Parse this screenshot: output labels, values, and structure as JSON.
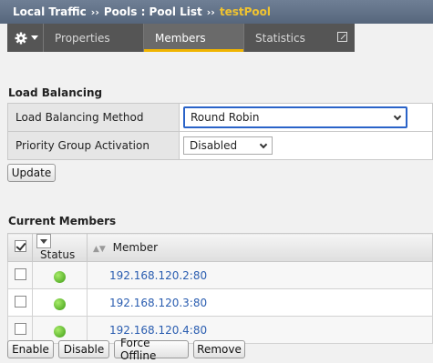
{
  "breadcrumb": {
    "items": [
      "Local Traffic",
      "Pools : Pool List"
    ],
    "current": "testPool",
    "separator": "››"
  },
  "tabs": [
    {
      "label": "Properties"
    },
    {
      "label": "Members",
      "active": true
    },
    {
      "label": "Statistics"
    }
  ],
  "load_balancing": {
    "title": "Load Balancing",
    "method_label": "Load Balancing Method",
    "method_value": "Round Robin",
    "priority_label": "Priority Group Activation",
    "priority_value": "Disabled",
    "update_button": "Update"
  },
  "current_members": {
    "title": "Current Members",
    "columns": {
      "status": "Status",
      "member": "Member"
    },
    "rows": [
      {
        "member": "192.168.120.2:80",
        "status_color": "#4caf1f"
      },
      {
        "member": "192.168.120.3:80",
        "status_color": "#4caf1f"
      },
      {
        "member": "192.168.120.4:80",
        "status_color": "#4caf1f"
      }
    ],
    "buttons": {
      "enable": "Enable",
      "disable": "Disable",
      "force_offline": "Force Offline",
      "remove": "Remove"
    }
  },
  "colors": {
    "accent": "#f0b400",
    "link": "#2a5db0",
    "focus": "#2a63c8"
  }
}
